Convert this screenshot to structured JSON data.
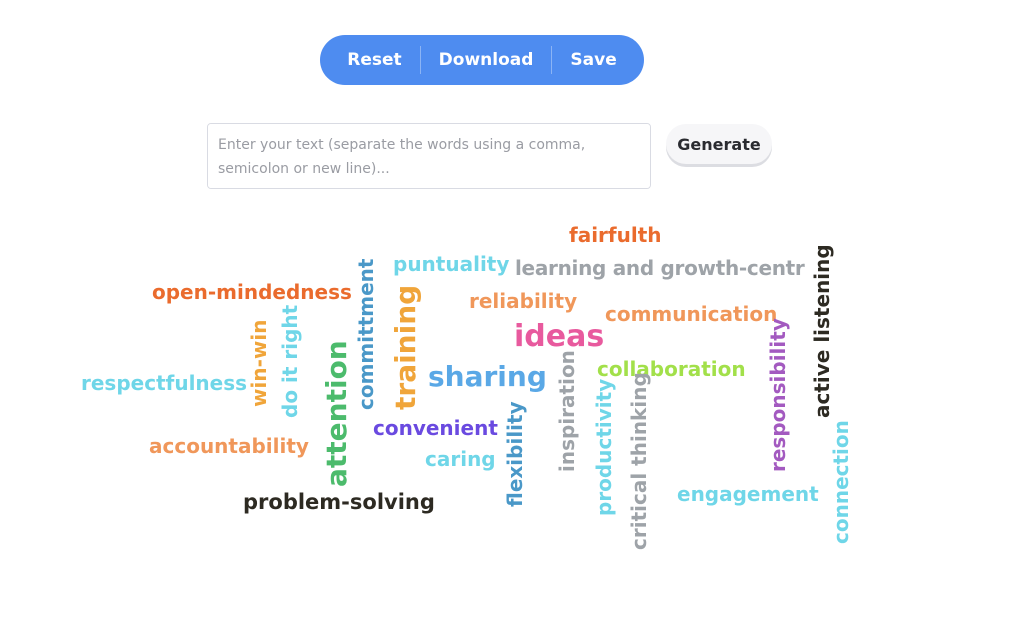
{
  "toolbar": {
    "reset_label": "Reset",
    "download_label": "Download",
    "save_label": "Save",
    "color": "#4e8cf0"
  },
  "input": {
    "value": "",
    "placeholder": "Enter your text (separate the words using a comma, semicolon or new line)..."
  },
  "generate_label": "Generate",
  "cloud": {
    "words": [
      {
        "text": "fairfulth",
        "color": "#ea6b2d",
        "orientation": "horizontal"
      },
      {
        "text": "puntuality",
        "color": "#6fd6e8",
        "orientation": "horizontal"
      },
      {
        "text": "learning and growth-centr",
        "color": "#9ea3a8",
        "orientation": "horizontal"
      },
      {
        "text": "open-mindedness",
        "color": "#ea6b2d",
        "orientation": "horizontal"
      },
      {
        "text": "reliability",
        "color": "#f0975a",
        "orientation": "horizontal"
      },
      {
        "text": "communication",
        "color": "#f0975a",
        "orientation": "horizontal"
      },
      {
        "text": "ideas",
        "color": "#e85a9e",
        "orientation": "horizontal"
      },
      {
        "text": "sharing",
        "color": "#5aa8e6",
        "orientation": "horizontal"
      },
      {
        "text": "collaboration",
        "color": "#a2e04a",
        "orientation": "horizontal"
      },
      {
        "text": "respectfulness",
        "color": "#6fd6e8",
        "orientation": "horizontal"
      },
      {
        "text": "convenient",
        "color": "#6a4ae0",
        "orientation": "horizontal"
      },
      {
        "text": "accountability",
        "color": "#f0975a",
        "orientation": "horizontal"
      },
      {
        "text": "caring",
        "color": "#6fd6e8",
        "orientation": "horizontal"
      },
      {
        "text": "engagement",
        "color": "#6fd6e8",
        "orientation": "horizontal"
      },
      {
        "text": "problem-solving",
        "color": "#2d2a22",
        "orientation": "horizontal"
      },
      {
        "text": "win-win",
        "color": "#f0a53a",
        "orientation": "vertical"
      },
      {
        "text": "do it right",
        "color": "#6fd6e8",
        "orientation": "vertical"
      },
      {
        "text": "attention",
        "color": "#4cbb6c",
        "orientation": "vertical"
      },
      {
        "text": "committment",
        "color": "#4a98c8",
        "orientation": "vertical"
      },
      {
        "text": "training",
        "color": "#f0a53a",
        "orientation": "vertical"
      },
      {
        "text": "flexibility",
        "color": "#4a98c8",
        "orientation": "vertical"
      },
      {
        "text": "inspiration",
        "color": "#9ea3a8",
        "orientation": "vertical"
      },
      {
        "text": "productivity",
        "color": "#6fd6e8",
        "orientation": "vertical"
      },
      {
        "text": "critical thinking",
        "color": "#9ea3a8",
        "orientation": "vertical"
      },
      {
        "text": "responsibility",
        "color": "#a35ac0",
        "orientation": "vertical"
      },
      {
        "text": "active listening",
        "color": "#2d2a22",
        "orientation": "vertical"
      },
      {
        "text": "connection",
        "color": "#6fd6e8",
        "orientation": "vertical"
      }
    ]
  }
}
